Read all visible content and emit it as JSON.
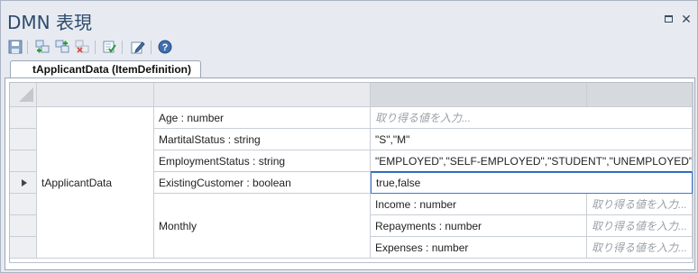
{
  "window": {
    "title": "DMN 表現"
  },
  "tab": {
    "label": "tApplicantData (ItemDefinition)"
  },
  "table": {
    "root_name": "tApplicantData",
    "rows": [
      {
        "name": "Age : number",
        "value": "取り得る値を入力..."
      },
      {
        "name": "MartitalStatus : string",
        "value": "\"S\",\"M\""
      },
      {
        "name": "EmploymentStatus : string",
        "value": "\"EMPLOYED\",\"SELF-EMPLOYED\",\"STUDENT\",\"UNEMPLOYED\""
      },
      {
        "name": "ExistingCustomer : boolean",
        "value": "true,false"
      }
    ],
    "group": {
      "name": "Monthly",
      "children": [
        {
          "name": "Income : number",
          "value": "取り得る値を入力..."
        },
        {
          "name": "Repayments : number",
          "value": "取り得る値を入力..."
        },
        {
          "name": "Expenses : number",
          "value": "取り得る値を入力..."
        }
      ]
    }
  },
  "icons": [
    "save-icon",
    "add-child-icon",
    "add-sibling-icon",
    "delete-icon",
    "validate-icon",
    "edit-icon",
    "help-icon"
  ]
}
